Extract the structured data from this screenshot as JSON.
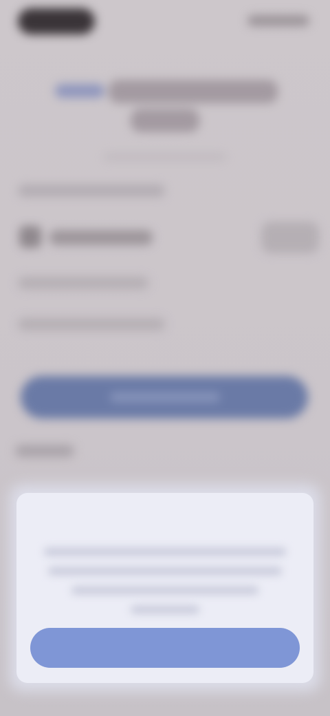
{
  "dialog": {
    "title": "",
    "message": "",
    "button_label": ""
  },
  "colors": {
    "background": "#cdc7cb",
    "accent": "#6a7aa6",
    "dialog_bg": "#ecedf6",
    "dialog_button": "#7f96d6"
  }
}
